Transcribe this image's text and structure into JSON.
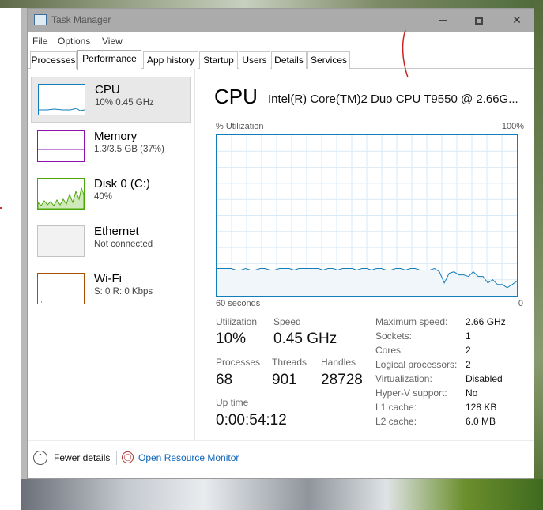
{
  "window": {
    "title": "Task Manager",
    "controls": {
      "minimize": "minimize",
      "maximize": "maximize",
      "close": "✕"
    }
  },
  "menu": [
    "File",
    "Options",
    "View"
  ],
  "tabs": [
    "Processes",
    "Performance",
    "App history",
    "Startup",
    "Users",
    "Details",
    "Services"
  ],
  "active_tab": "Performance",
  "resources": [
    {
      "name": "CPU",
      "detail": "10%  0.45 GHz",
      "color": "#117dbb"
    },
    {
      "name": "Memory",
      "detail": "1.3/3.5 GB (37%)",
      "color": "#8b12ae"
    },
    {
      "name": "Disk 0 (C:)",
      "detail": "40%",
      "color": "#4da60c"
    },
    {
      "name": "Ethernet",
      "detail": "Not connected",
      "color": "#c2c2c2"
    },
    {
      "name": "Wi-Fi",
      "detail": "S: 0  R: 0 Kbps",
      "color": "#a74f01"
    }
  ],
  "cpu": {
    "title": "CPU",
    "model": "Intel(R) Core(TM)2 Duo CPU T9550 @ 2.66G...",
    "util_label": "% Utilization",
    "util_max": "100%",
    "time_left": "60 seconds",
    "time_right": "0",
    "stats": {
      "utilization_label": "Utilization",
      "utilization": "10%",
      "speed_label": "Speed",
      "speed": "0.45 GHz",
      "processes_label": "Processes",
      "processes": "68",
      "threads_label": "Threads",
      "threads": "901",
      "handles_label": "Handles",
      "handles": "28728",
      "uptime_label": "Up time",
      "uptime": "0:00:54:12"
    },
    "specs": [
      {
        "key": "Maximum speed:",
        "value": "2.66 GHz"
      },
      {
        "key": "Sockets:",
        "value": "1"
      },
      {
        "key": "Cores:",
        "value": "2"
      },
      {
        "key": "Logical processors:",
        "value": "2"
      },
      {
        "key": "Virtualization:",
        "value": "Disabled"
      },
      {
        "key": "Hyper-V support:",
        "value": "No"
      },
      {
        "key": "L1 cache:",
        "value": "128 KB"
      },
      {
        "key": "L2 cache:",
        "value": "6.0 MB"
      }
    ],
    "history": [
      17,
      17,
      17,
      17,
      16,
      16,
      17,
      16,
      16,
      17,
      17,
      16,
      16,
      17,
      17,
      17,
      16,
      17,
      17,
      17,
      17,
      17,
      16,
      17,
      17,
      16,
      17,
      17,
      17,
      16,
      17,
      17,
      16,
      17,
      17,
      16,
      16,
      17,
      17,
      16,
      17,
      17,
      16,
      16,
      16,
      17,
      15,
      8,
      14,
      15,
      13,
      13,
      12,
      15,
      12,
      12,
      8,
      10,
      7,
      7,
      5,
      7,
      9
    ]
  },
  "footer": {
    "fewer_details": "Fewer details",
    "open_monitor": "Open Resource Monitor"
  }
}
